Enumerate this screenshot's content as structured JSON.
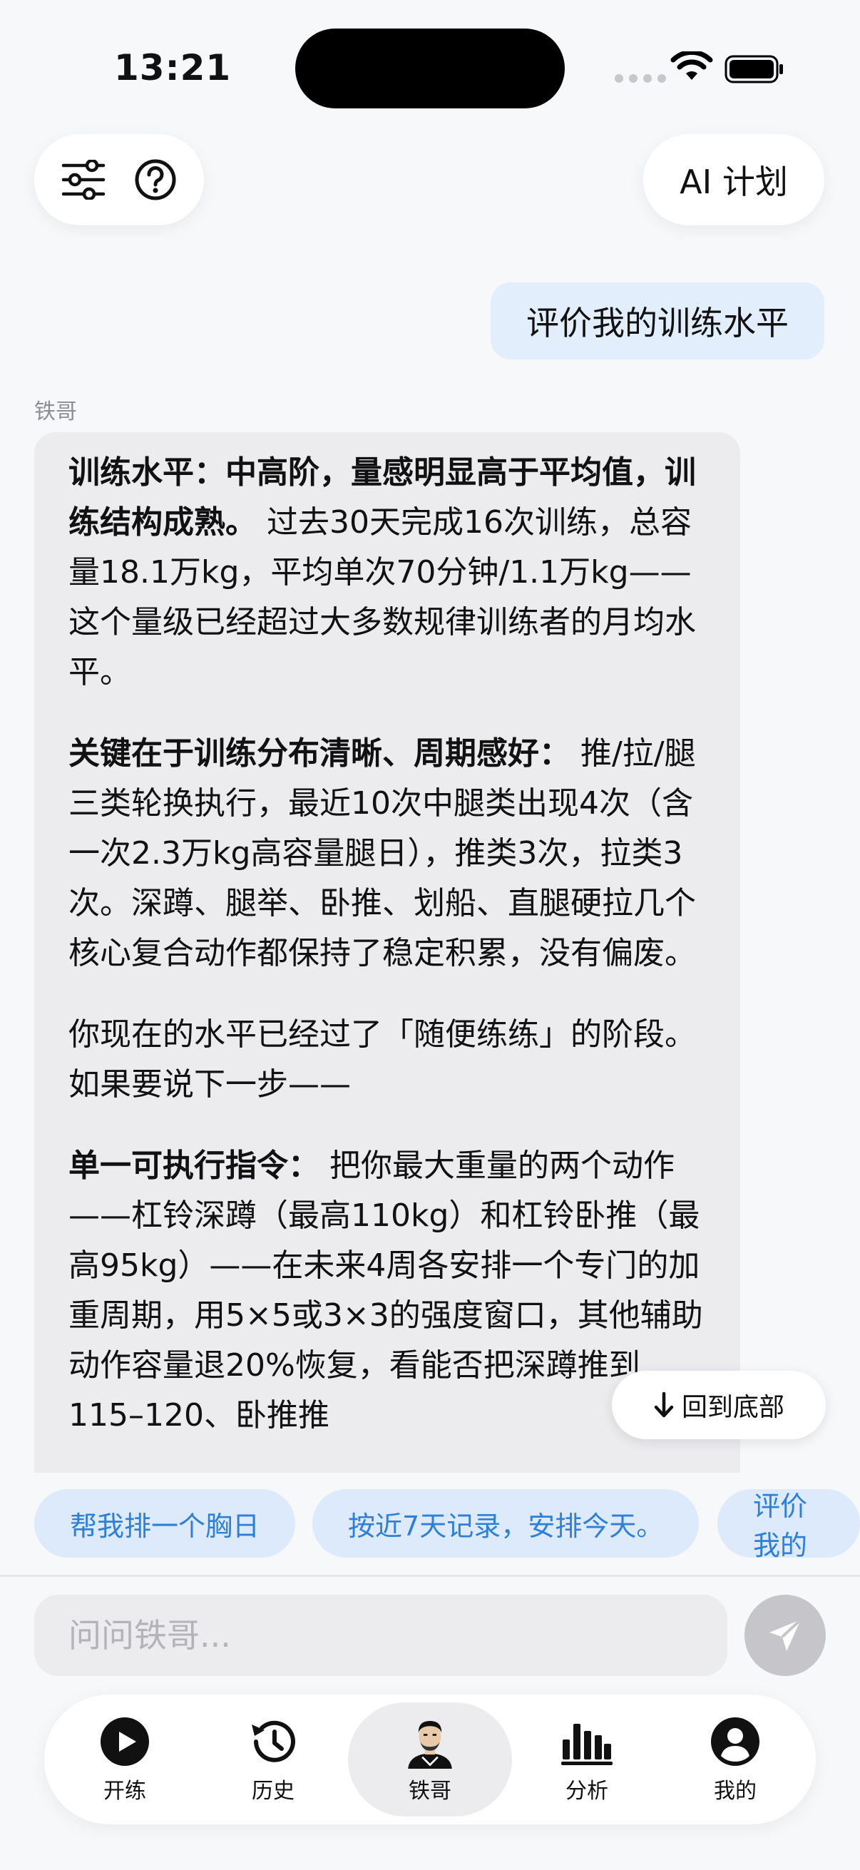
{
  "status_bar": {
    "time": "13:21"
  },
  "header": {
    "ai_plan_label": "AI 计划"
  },
  "chat": {
    "user_message": "评价我的训练水平",
    "sender": "铁哥",
    "paragraphs": [
      {
        "bold": "训练水平：中高阶，量感明显高于平均值，训练结构成熟。",
        "text": " 过去30天完成16次训练，总容量18.1万kg，平均单次70分钟/1.1万kg——这个量级已经超过大多数规律训练者的月均水平。"
      },
      {
        "bold": "关键在于训练分布清晰、周期感好：",
        "text": " 推/拉/腿三类轮换执行，最近10次中腿类出现4次（含一次2.3万kg高容量腿日），推类3次，拉类3次。深蹲、腿举、卧推、划船、直腿硬拉几个核心复合动作都保持了稳定积累，没有偏废。"
      },
      {
        "bold": "",
        "text": "你现在的水平已经过了「随便练练」的阶段。如果要说下一步——"
      },
      {
        "bold": "单一可执行指令：",
        "text": " 把你最大重量的两个动作——杠铃深蹲（最高110kg）和杠铃卧推（最高95kg）——在未来4周各安排一个专门的加重周期，用5×5或3×3的强度窗口，其他辅助动作容量退20%恢复，看能否把深蹲推到115–120、卧推推"
      }
    ],
    "back_to_bottom_label": "回到底部"
  },
  "suggestions": [
    "帮我排一个胸日",
    "按近7天记录，安排今天。",
    "评价我的"
  ],
  "input": {
    "placeholder": "问问铁哥..."
  },
  "tabs": [
    {
      "label": "开练",
      "icon": "play-icon",
      "active": false
    },
    {
      "label": "历史",
      "icon": "history-icon",
      "active": false
    },
    {
      "label": "铁哥",
      "icon": "coach-avatar-icon",
      "active": true
    },
    {
      "label": "分析",
      "icon": "bar-chart-icon",
      "active": false
    },
    {
      "label": "我的",
      "icon": "profile-icon",
      "active": false
    }
  ],
  "colors": {
    "accent_blue": "#2d7fd8",
    "chip_bg": "#dceafc",
    "user_bubble_bg": "#e2eefc",
    "ai_bubble_bg": "#ececef",
    "send_disabled": "#c6c6ca"
  }
}
